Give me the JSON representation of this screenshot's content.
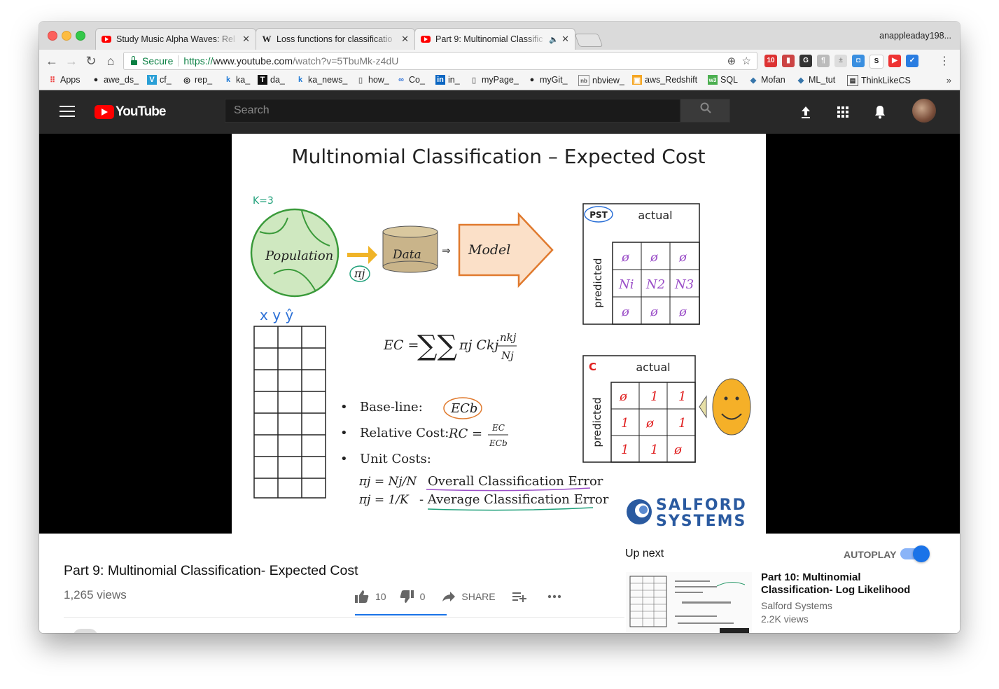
{
  "browser": {
    "tabs": [
      {
        "title": "Study Music Alpha Waves: Rel",
        "favicon": "youtube-icon"
      },
      {
        "title": "Loss functions for classificatio",
        "favicon": "wikipedia-icon"
      },
      {
        "title": "Part 9: Multinomial Classific",
        "favicon": "youtube-icon",
        "active": true
      }
    ],
    "profile": "anappleaday198...",
    "secure_label": "Secure",
    "url_scheme": "https://",
    "url_host": "www.youtube.com",
    "url_path": "/watch?v=5TbuMk-z4dU"
  },
  "bookmarks": [
    {
      "label": "Apps",
      "icon": "apps-grid-icon"
    },
    {
      "label": "awe_ds_",
      "icon": "github-icon"
    },
    {
      "label": "cf_",
      "icon": "v-icon"
    },
    {
      "label": "rep_",
      "icon": "circle-icon"
    },
    {
      "label": "ka_",
      "icon": "k-icon"
    },
    {
      "label": "da_",
      "icon": "t-icon"
    },
    {
      "label": "ka_news_",
      "icon": "k-icon"
    },
    {
      "label": "how_",
      "icon": "page-icon"
    },
    {
      "label": "Co_",
      "icon": "infinity-icon"
    },
    {
      "label": "in_",
      "icon": "linkedin-icon"
    },
    {
      "label": "myPage_",
      "icon": "page-icon"
    },
    {
      "label": "myGit_",
      "icon": "github-icon"
    },
    {
      "label": "nbview_",
      "icon": "nb-icon"
    },
    {
      "label": "aws_Redshift",
      "icon": "aws-icon"
    },
    {
      "label": "SQL",
      "icon": "w3-icon"
    },
    {
      "label": "Mofan",
      "icon": "python-icon"
    },
    {
      "label": "ML_tut",
      "icon": "python-icon"
    },
    {
      "label": "ThinkLikeCS",
      "icon": "page-icon"
    }
  ],
  "youtube": {
    "logo_text": "YouTube",
    "search_placeholder": "Search"
  },
  "slide": {
    "title": "Multinomial Classification – Expected Cost",
    "pst_table": {
      "badge": "PST",
      "header": "actual",
      "side": "predicted"
    },
    "cost_table": {
      "badge": "C",
      "header": "actual",
      "side": "predicted"
    },
    "formula_lhs": "EC =",
    "bullets": [
      "Base-line:",
      "Relative Cost:",
      "Unit Costs:"
    ],
    "overall_error": "Overall Classification Error",
    "average_error": "- Average Classification Error",
    "logo_line1": "SALFORD",
    "logo_line2": "SYSTEMS"
  },
  "video": {
    "title": "Part 9: Multinomial Classification- Expected Cost",
    "views": "1,265 views",
    "likes": "10",
    "dislikes": "0",
    "share_label": "SHARE"
  },
  "sidebar": {
    "upnext_label": "Up next",
    "autoplay_label": "AUTOPLAY",
    "autoplay_on": true,
    "next_title": "Part 10: Multinomial Classification- Log Likelihood",
    "next_channel": "Salford Systems",
    "next_views": "2.2K views"
  }
}
